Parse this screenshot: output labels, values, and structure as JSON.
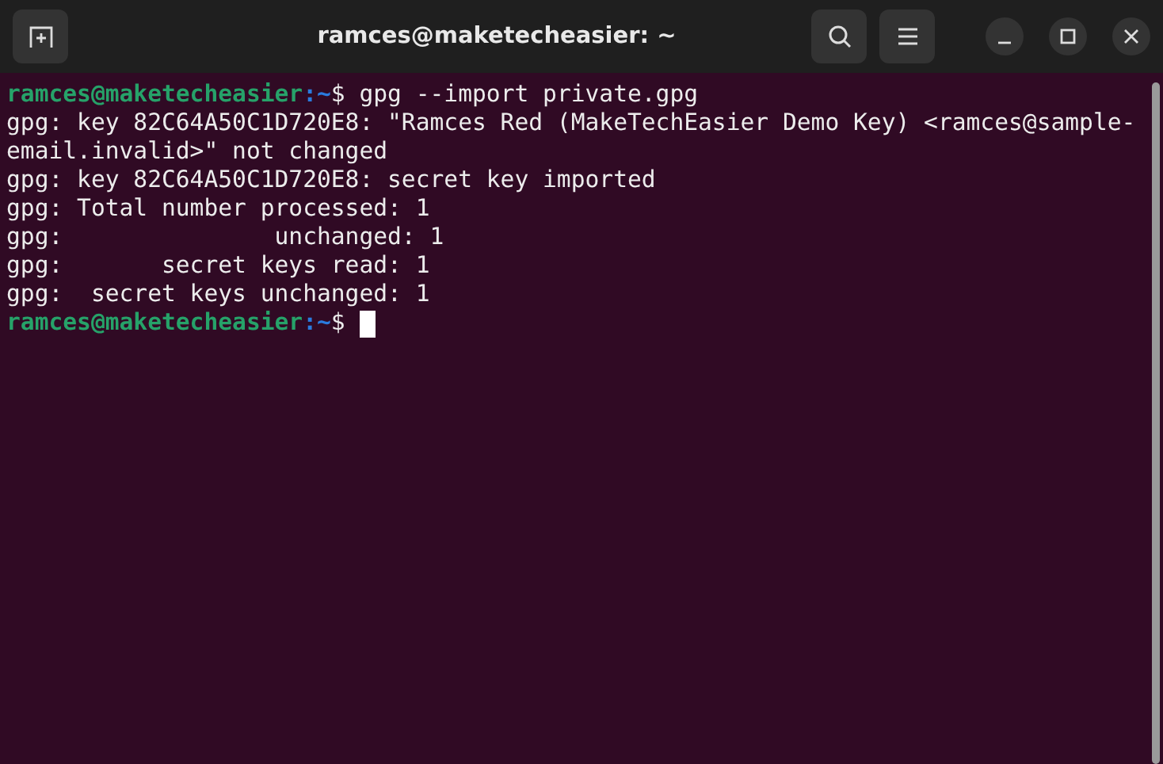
{
  "window": {
    "title": "ramces@maketecheasier: ~"
  },
  "terminal": {
    "lines": [
      {
        "kind": "prompt",
        "user_host": "ramces@maketecheasier",
        "path": ":~",
        "symbol": "$ ",
        "command": "gpg --import private.gpg"
      },
      {
        "kind": "output",
        "text": "gpg: key 82C64A50C1D720E8: \"Ramces Red (MakeTechEasier Demo Key) <ramces@sample-"
      },
      {
        "kind": "output",
        "text": "email.invalid>\" not changed"
      },
      {
        "kind": "output",
        "text": "gpg: key 82C64A50C1D720E8: secret key imported"
      },
      {
        "kind": "output",
        "text": "gpg: Total number processed: 1"
      },
      {
        "kind": "output",
        "text": "gpg:               unchanged: 1"
      },
      {
        "kind": "output",
        "text": "gpg:       secret keys read: 1"
      },
      {
        "kind": "output",
        "text": "gpg:  secret keys unchanged: 1"
      },
      {
        "kind": "prompt",
        "user_host": "ramces@maketecheasier",
        "path": ":~",
        "symbol": "$ ",
        "cursor": true
      }
    ]
  }
}
